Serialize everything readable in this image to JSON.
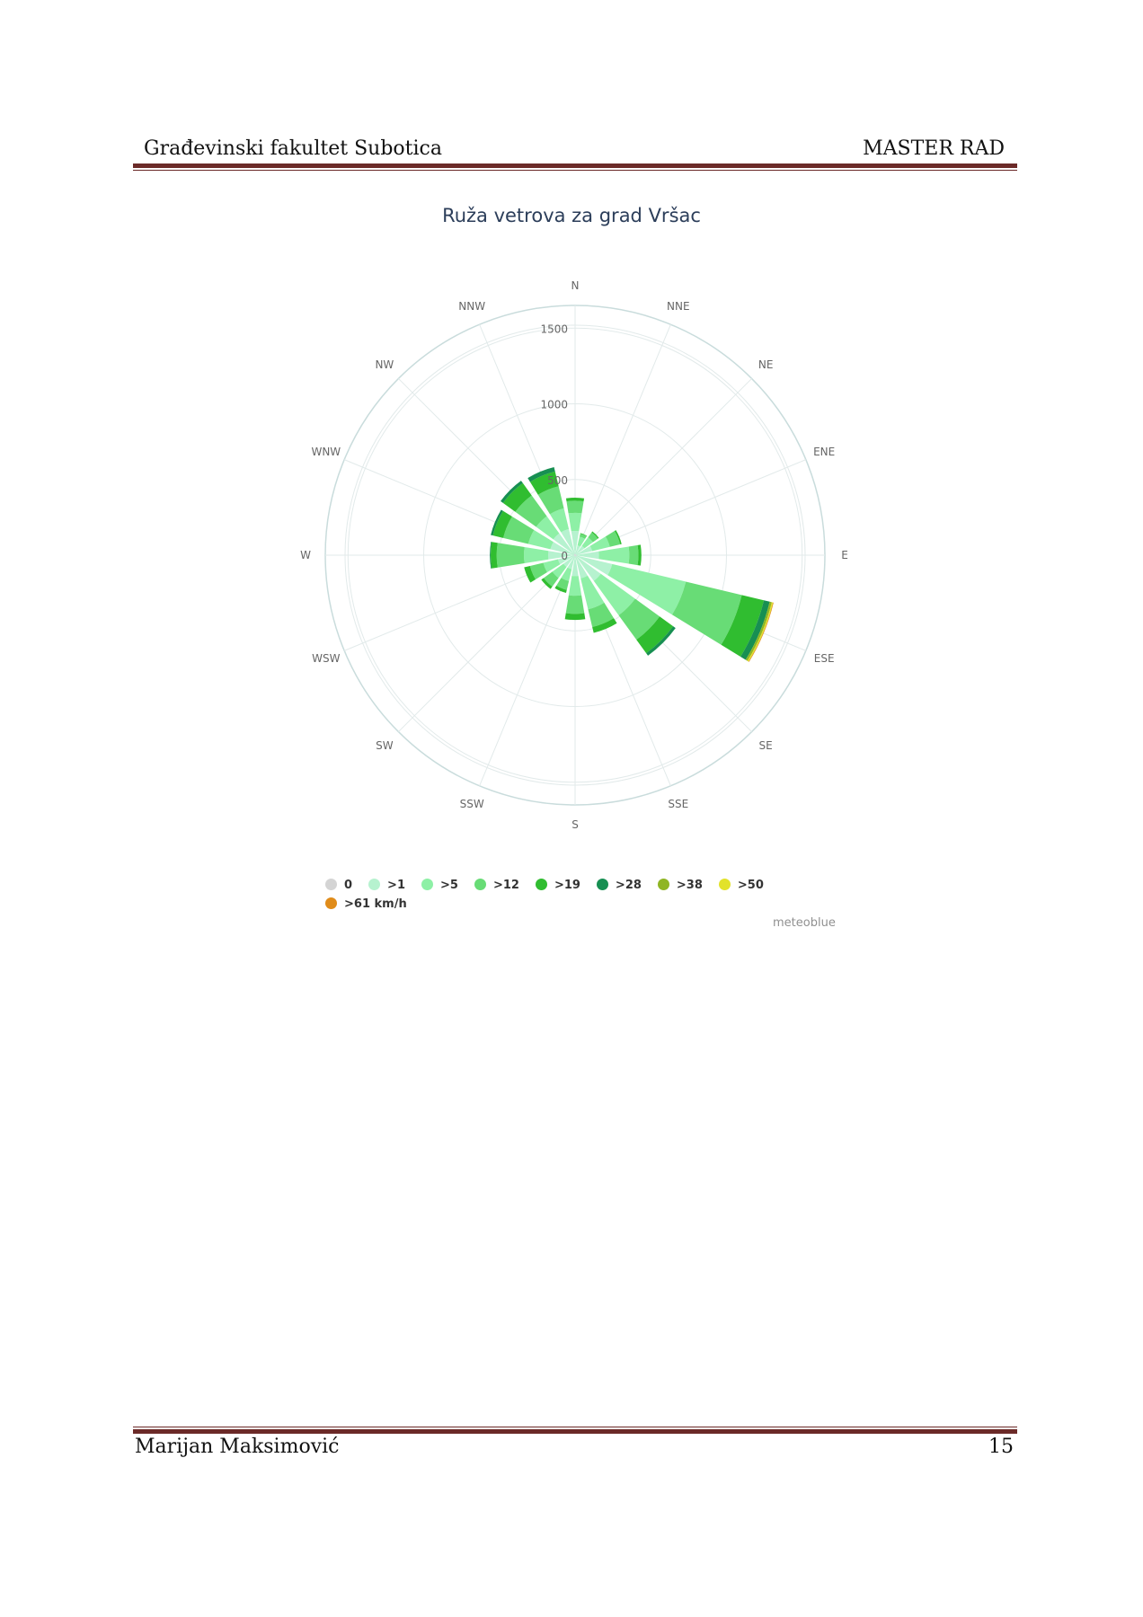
{
  "header": {
    "left": "Građevinski fakultet Subotica",
    "right": "MASTER RAD"
  },
  "footer": {
    "author": "Marijan Maksimović",
    "page_number": "15"
  },
  "figure": {
    "credit": "meteoblue"
  },
  "chart_data": {
    "type": "wind-rose (stacked polar bar)",
    "title": "Ruža vetrova za grad Vršac",
    "directions": [
      "N",
      "NNE",
      "NE",
      "ENE",
      "E",
      "ESE",
      "SE",
      "SSE",
      "S",
      "SSW",
      "SW",
      "WSW",
      "W",
      "WNW",
      "NW",
      "NNW"
    ],
    "radial_axis": {
      "ticks": [
        0,
        500,
        1000,
        1500
      ],
      "tick_labels": [
        "0",
        "500",
        "1000",
        "1500"
      ],
      "max": 1650
    },
    "grid": true,
    "legend_position": "bottom",
    "categories": [
      "0",
      ">1",
      ">5",
      ">12",
      ">19",
      ">28",
      ">38",
      ">50",
      ">61 km/h"
    ],
    "colors": [
      "#d4d4d4",
      "#b6f2cf",
      "#8ef0a6",
      "#68dc76",
      "#30bd30",
      "#178f52",
      "#8fb523",
      "#e2e22a",
      "#e08c1a"
    ],
    "series": [
      {
        "name": "0",
        "values": [
          10,
          6,
          6,
          6,
          8,
          12,
          10,
          8,
          8,
          6,
          6,
          6,
          8,
          8,
          8,
          8
        ]
      },
      {
        "name": ">1",
        "values": [
          150,
          60,
          70,
          110,
          150,
          240,
          200,
          150,
          130,
          90,
          90,
          110,
          170,
          160,
          170,
          170
        ]
      },
      {
        "name": ">5",
        "values": [
          120,
          60,
          70,
          120,
          200,
          500,
          280,
          210,
          130,
          80,
          90,
          100,
          160,
          150,
          140,
          140
        ]
      },
      {
        "name": ">12",
        "values": [
          80,
          20,
          40,
          70,
          60,
          380,
          200,
          120,
          120,
          60,
          70,
          90,
          180,
          170,
          170,
          150
        ]
      },
      {
        "name": ">19",
        "values": [
          20,
          4,
          8,
          10,
          20,
          150,
          110,
          40,
          40,
          20,
          20,
          40,
          40,
          70,
          100,
          100
        ]
      },
      {
        "name": ">28",
        "values": [
          0,
          0,
          0,
          0,
          0,
          40,
          20,
          0,
          0,
          0,
          0,
          0,
          5,
          15,
          20,
          30
        ]
      },
      {
        "name": ">38",
        "values": [
          0,
          0,
          0,
          0,
          0,
          14,
          0,
          0,
          0,
          0,
          0,
          0,
          0,
          0,
          0,
          0
        ]
      },
      {
        "name": ">50",
        "values": [
          0,
          0,
          0,
          0,
          0,
          8,
          0,
          0,
          0,
          0,
          0,
          0,
          0,
          0,
          0,
          0
        ]
      },
      {
        "name": ">61 km/h",
        "values": [
          0,
          0,
          0,
          0,
          0,
          4,
          0,
          0,
          0,
          0,
          0,
          0,
          0,
          0,
          0,
          0
        ]
      }
    ]
  }
}
